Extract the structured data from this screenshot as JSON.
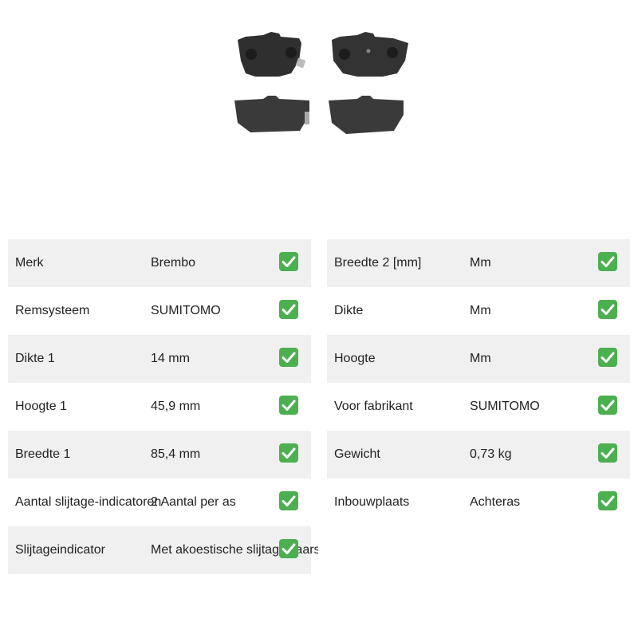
{
  "product": {
    "image_icon": "brake-pads-image"
  },
  "specs_left": [
    {
      "label": "Merk",
      "value": "Brembo"
    },
    {
      "label": "Remsysteem",
      "value": "SUMITOMO"
    },
    {
      "label": "Dikte 1",
      "value": "14 mm"
    },
    {
      "label": "Hoogte 1",
      "value": "45,9 mm"
    },
    {
      "label": "Breedte 1",
      "value": "85,4 mm"
    },
    {
      "label": "Aantal slijtage-indicatoren",
      "value": "2 Aantal per as"
    },
    {
      "label": "Slijtageindicator",
      "value": "Met akoestische slijtagewaarschuwing"
    }
  ],
  "specs_right": [
    {
      "label": "Breedte 2 [mm]",
      "value": "Mm"
    },
    {
      "label": "Dikte",
      "value": "Mm"
    },
    {
      "label": "Hoogte",
      "value": "Mm"
    },
    {
      "label": "Voor fabrikant",
      "value": "SUMITOMO"
    },
    {
      "label": "Gewicht",
      "value": "0,73 kg"
    },
    {
      "label": "Inbouwplaats",
      "value": "Achteras"
    }
  ],
  "colors": {
    "row_shade": "#f0f0f0",
    "check_green": "#4caf50"
  },
  "icons": {
    "check": "check-mark-icon"
  }
}
